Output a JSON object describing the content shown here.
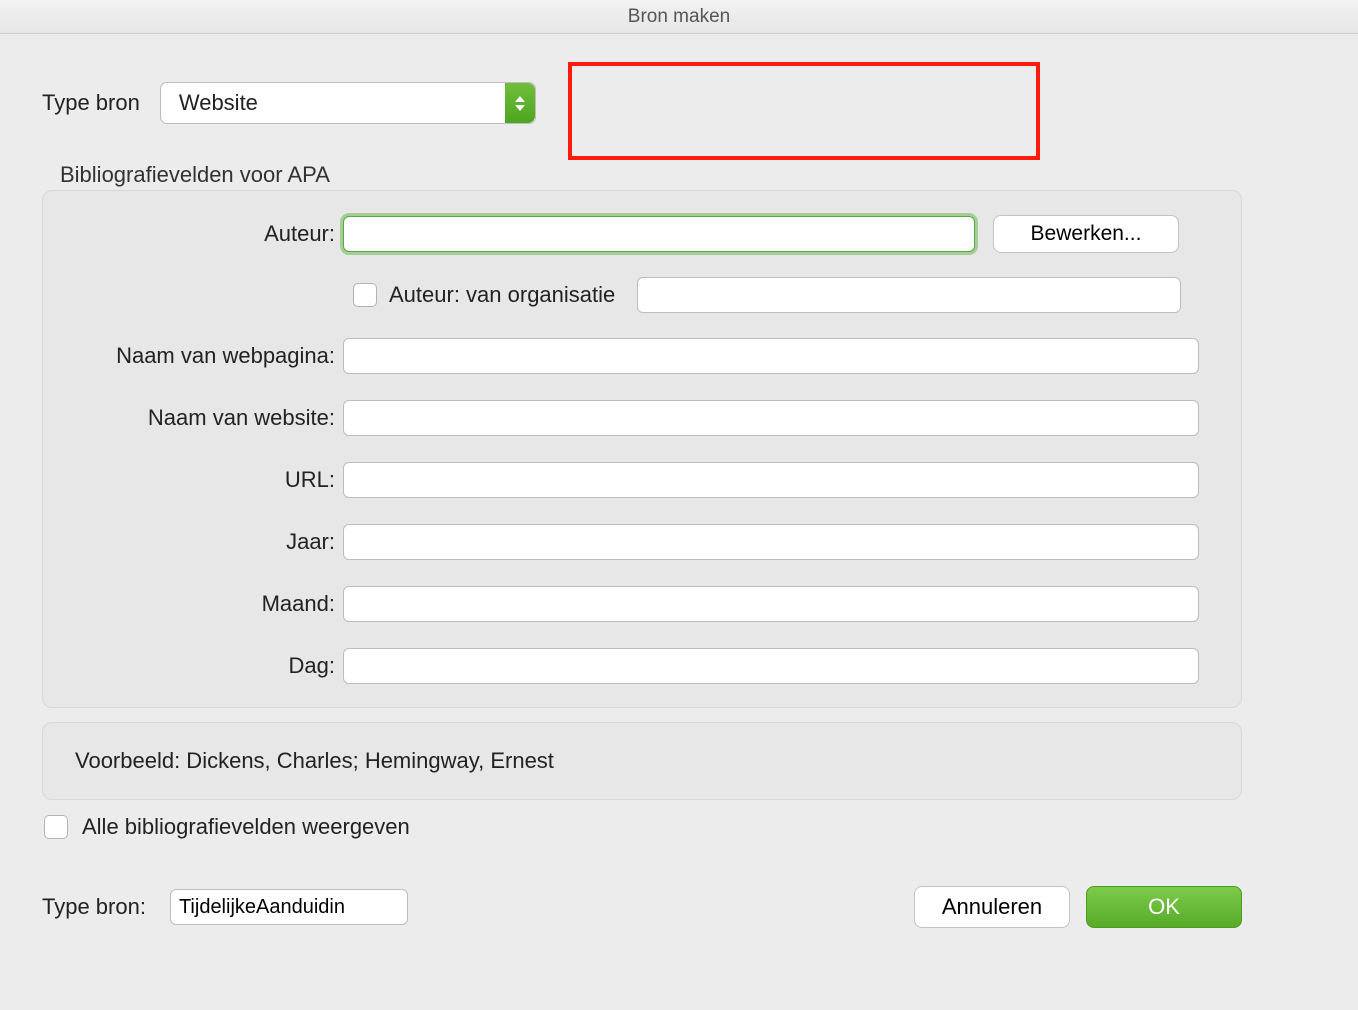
{
  "title": "Bron maken",
  "top": {
    "label": "Type bron",
    "selected": "Website"
  },
  "fieldset": {
    "legend": "Bibliografievelden voor APA",
    "auteur": {
      "label": "Auteur:",
      "value": "",
      "edit_button": "Bewerken..."
    },
    "org": {
      "checkbox_label": "Auteur: van organisatie",
      "value": ""
    },
    "naam_webpagina": {
      "label": "Naam van webpagina:",
      "value": ""
    },
    "naam_website": {
      "label": "Naam van website:",
      "value": ""
    },
    "url": {
      "label": "URL:",
      "value": ""
    },
    "jaar": {
      "label": "Jaar:",
      "value": ""
    },
    "maand": {
      "label": "Maand:",
      "value": ""
    },
    "dag": {
      "label": "Dag:",
      "value": ""
    }
  },
  "example": "Voorbeeld: Dickens, Charles; Hemingway, Ernest",
  "show_all_label": "Alle bibliografievelden weergeven",
  "bottom": {
    "label": "Type bron:",
    "value": "TijdelijkeAanduidin",
    "cancel": "Annuleren",
    "ok": "OK"
  }
}
